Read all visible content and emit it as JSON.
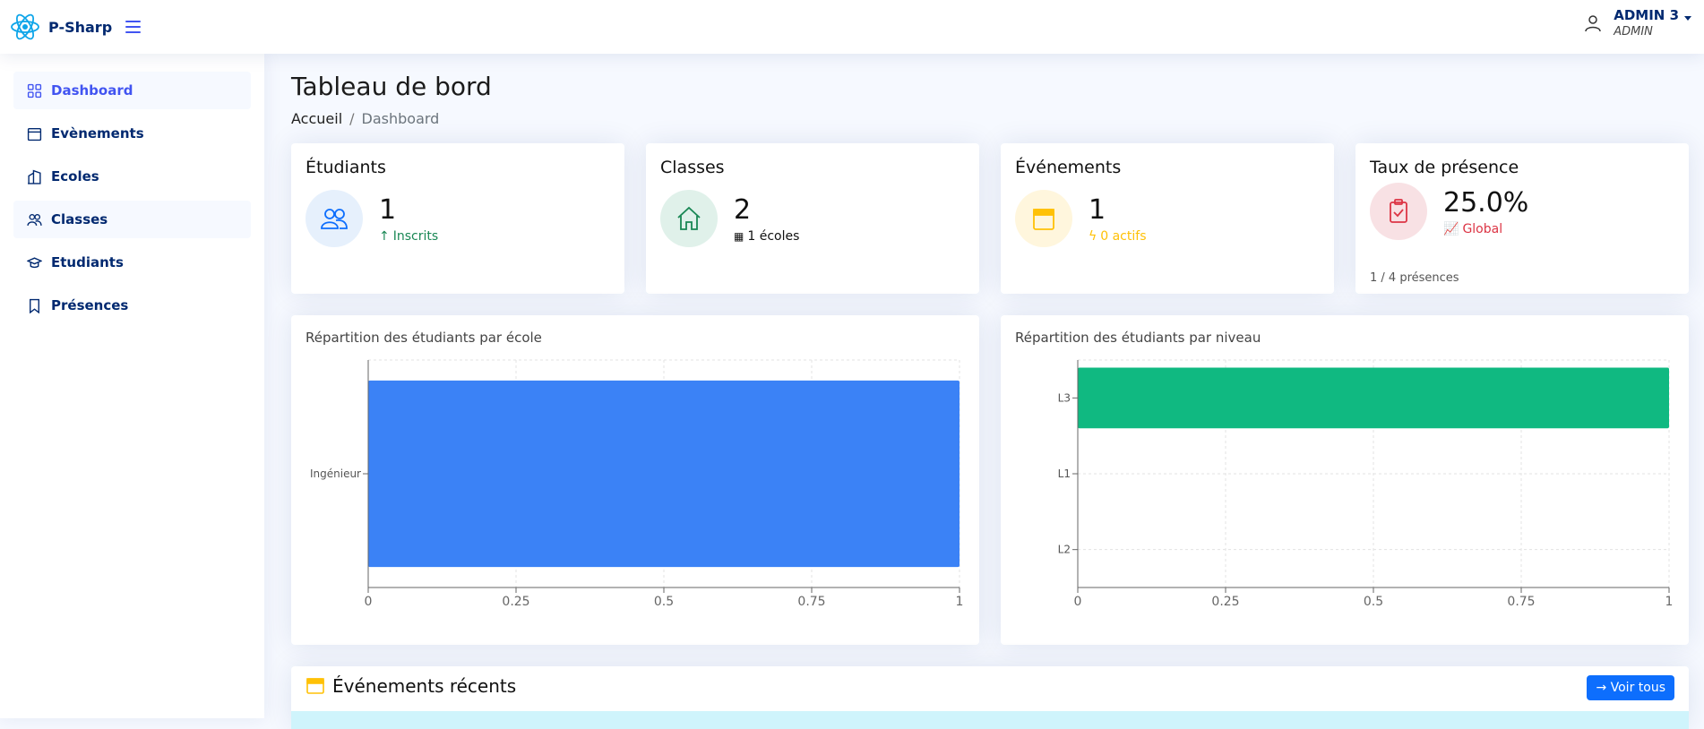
{
  "header": {
    "app_name": "P-Sharp",
    "user_name": "ADMIN 3",
    "user_role": "ADMIN"
  },
  "sidebar": {
    "items": [
      {
        "label": "Dashboard",
        "icon": "grid-icon"
      },
      {
        "label": "Evènements",
        "icon": "calendar-icon"
      },
      {
        "label": "Ecoles",
        "icon": "building-icon"
      },
      {
        "label": "Classes",
        "icon": "people-icon"
      },
      {
        "label": "Etudiants",
        "icon": "mortarboard-icon"
      },
      {
        "label": "Présences",
        "icon": "bookmark-icon"
      }
    ]
  },
  "page": {
    "title": "Tableau de bord",
    "breadcrumb": [
      "Accueil",
      "Dashboard"
    ]
  },
  "stats": {
    "students": {
      "title": "Étudiants",
      "value": "1",
      "sub": "Inscrits",
      "color": "#198754"
    },
    "classes": {
      "title": "Classes",
      "value": "2",
      "sub": "1 écoles",
      "color": "#111111"
    },
    "events": {
      "title": "Événements",
      "value": "1",
      "sub": "0 actifs",
      "color": "#ffc107"
    },
    "attendance": {
      "title": "Taux de présence",
      "value": "25.0%",
      "sub": "Global",
      "footer": "1 / 4 présences",
      "color": "#dc3545"
    }
  },
  "chart_data": [
    {
      "type": "bar",
      "orientation": "horizontal",
      "title": "Répartition des étudiants par école",
      "categories": [
        "Ingénieur"
      ],
      "values": [
        1
      ],
      "xlim": [
        0,
        1
      ],
      "xticks": [
        "0",
        "0.25",
        "0.5",
        "0.75",
        "1"
      ],
      "color": "#3b82f6",
      "grid": true
    },
    {
      "type": "bar",
      "orientation": "horizontal",
      "title": "Répartition des étudiants par niveau",
      "categories": [
        "L3",
        "L1",
        "L2"
      ],
      "values": [
        1,
        0,
        0
      ],
      "xlim": [
        0,
        1
      ],
      "xticks": [
        "0",
        "0.25",
        "0.5",
        "0.75",
        "1"
      ],
      "color": "#10b981",
      "grid": true
    }
  ],
  "events": {
    "title": "Événements récents",
    "button_label": "→ Voir tous"
  }
}
